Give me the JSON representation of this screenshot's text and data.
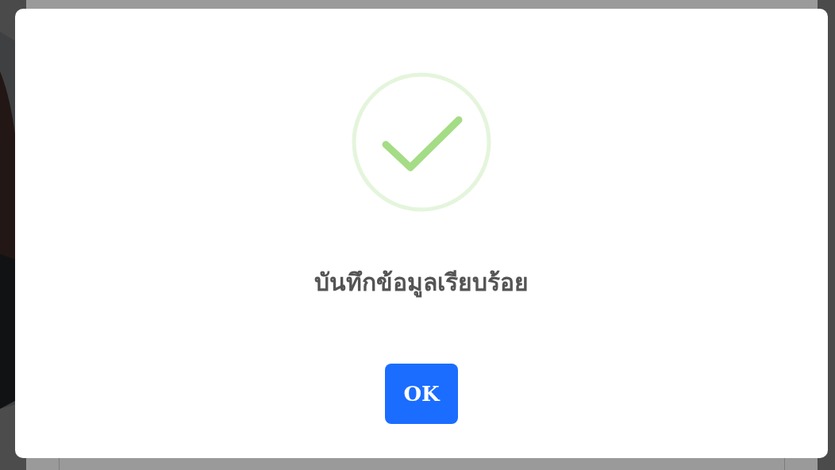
{
  "dialog": {
    "icon": {
      "kind": "success"
    },
    "message": "บันทึกข้อมูลเรียบร้อย",
    "button": {
      "label": "OK"
    }
  }
}
